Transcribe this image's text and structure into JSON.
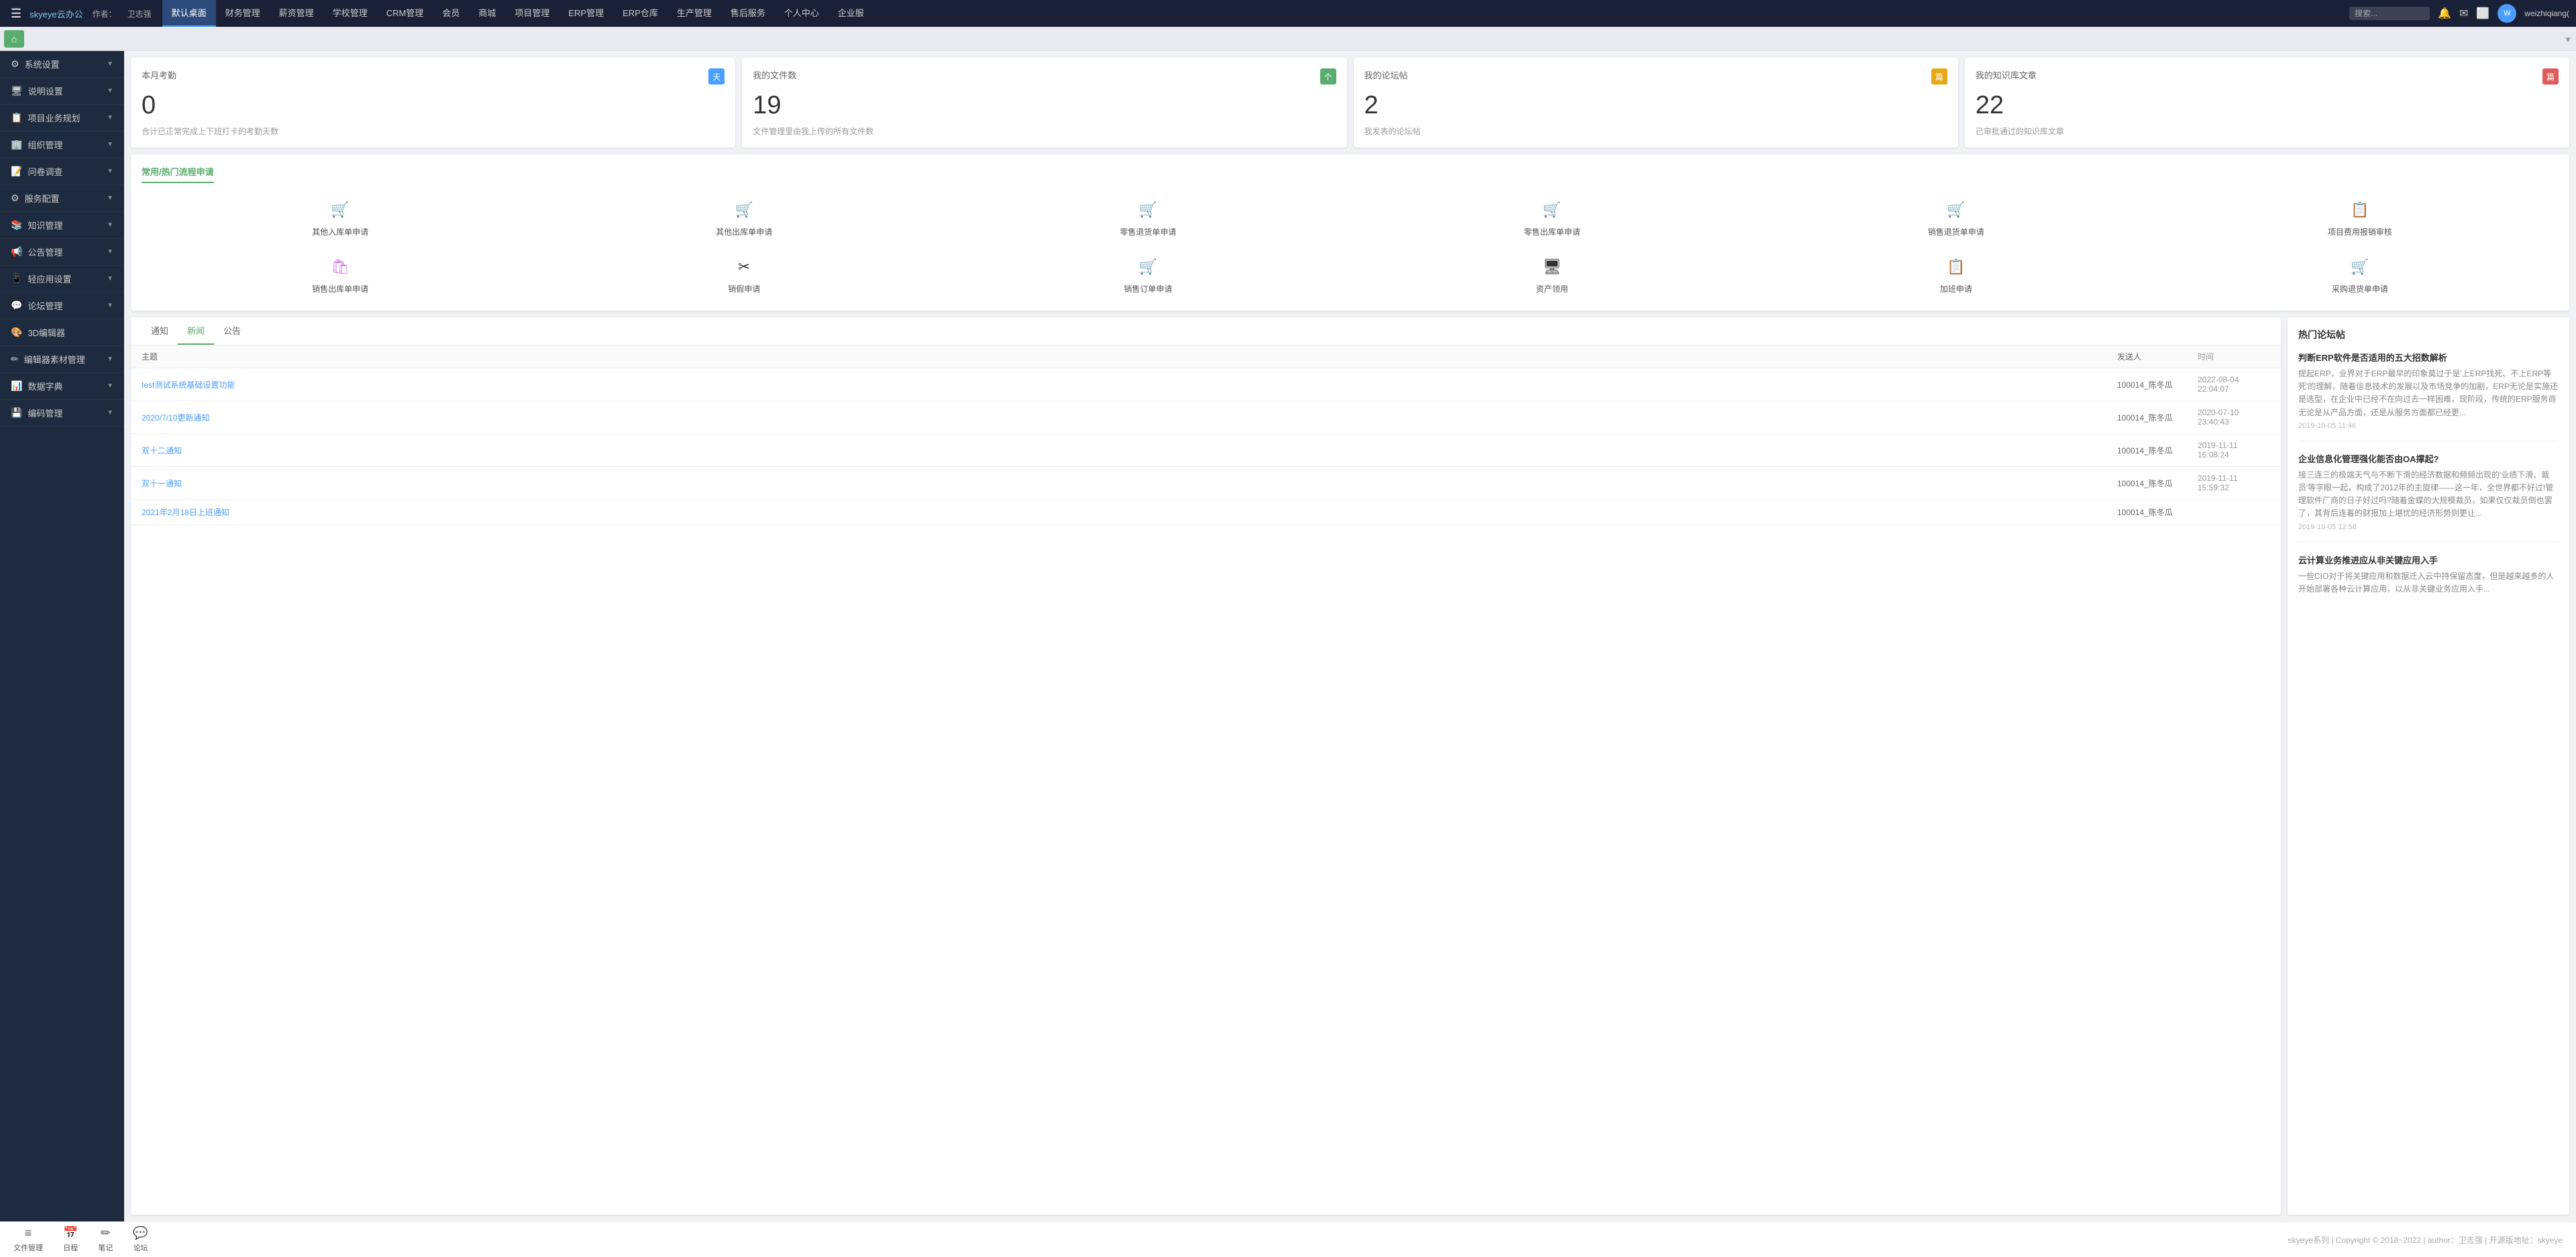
{
  "brand": {
    "name": "skyeye云办公",
    "author_label": "作者：",
    "author": "卫志强"
  },
  "top_nav": {
    "menu_icon": "☰",
    "tabs": [
      {
        "label": "默认桌面",
        "active": true
      },
      {
        "label": "财务管理"
      },
      {
        "label": "薪资管理"
      },
      {
        "label": "学校管理"
      },
      {
        "label": "CRM管理"
      },
      {
        "label": "会员"
      },
      {
        "label": "商城"
      },
      {
        "label": "项目管理"
      },
      {
        "label": "ERP管理"
      },
      {
        "label": "ERP仓库"
      },
      {
        "label": "生产管理"
      },
      {
        "label": "售后服务"
      },
      {
        "label": "个人中心"
      },
      {
        "label": "企业服"
      }
    ],
    "search_placeholder": "搜索...",
    "user": "weizhiqiang("
  },
  "second_nav": {
    "home_icon": "⌂"
  },
  "sidebar": {
    "items": [
      {
        "icon": "⚙",
        "label": "系统设置",
        "has_arrow": true
      },
      {
        "icon": "🖥",
        "label": "说明设置",
        "has_arrow": true
      },
      {
        "icon": "📋",
        "label": "项目业务规划",
        "has_arrow": true
      },
      {
        "icon": "🏢",
        "label": "组织管理",
        "has_arrow": true
      },
      {
        "icon": "📝",
        "label": "问卷调查",
        "has_arrow": true
      },
      {
        "icon": "⚙",
        "label": "服务配置",
        "has_arrow": true
      },
      {
        "icon": "📚",
        "label": "知识管理",
        "has_arrow": true
      },
      {
        "icon": "📢",
        "label": "公告管理",
        "has_arrow": true
      },
      {
        "icon": "📱",
        "label": "轻应用设置",
        "has_arrow": true
      },
      {
        "icon": "💬",
        "label": "论坛管理",
        "has_arrow": true
      },
      {
        "icon": "🎨",
        "label": "3D编辑器",
        "has_arrow": false
      },
      {
        "icon": "✏",
        "label": "编辑器素材管理",
        "has_arrow": true
      },
      {
        "icon": "📊",
        "label": "数据字典",
        "has_arrow": true
      },
      {
        "icon": "💾",
        "label": "编码管理",
        "has_arrow": true
      }
    ]
  },
  "stats": [
    {
      "title": "本月考勤",
      "badge_text": "天",
      "badge_color": "#4a9eff",
      "number": "0",
      "desc": "合计已正常完成上下班打卡的考勤天数"
    },
    {
      "title": "我的文件数",
      "badge_text": "个",
      "badge_color": "#5aad6e",
      "number": "19",
      "desc": "文件管理里由我上传的所有文件数"
    },
    {
      "title": "我的论坛帖",
      "badge_text": "篇",
      "badge_color": "#e6a817",
      "number": "2",
      "desc": "我发表的论坛帖"
    },
    {
      "title": "我的知识库文章",
      "badge_text": "篇",
      "badge_color": "#e05c5c",
      "number": "22",
      "desc": "已审批通过的知识库文章"
    }
  ],
  "flow_section": {
    "title": "常用/热门流程申请",
    "items": [
      {
        "icon": "🛒",
        "icon_color": "#e05c5c",
        "label": "其他入库单申请"
      },
      {
        "icon": "🛒",
        "icon_color": "#e05c5c",
        "label": "其他出库单申请"
      },
      {
        "icon": "🛒",
        "icon_color": "#e05c5c",
        "label": "零售退货单申请"
      },
      {
        "icon": "🛒",
        "icon_color": "#7b5ea7",
        "label": "零售出库单申请"
      },
      {
        "icon": "🛒",
        "icon_color": "#e05c5c",
        "label": "销售退货单申请"
      },
      {
        "icon": "📋",
        "icon_color": "#5aad6e",
        "label": "项目费用报销审核"
      },
      {
        "icon": "🛍",
        "icon_color": "#d47adb",
        "label": "销售出库单申请"
      },
      {
        "icon": "✂",
        "icon_color": "#333",
        "label": "销假申请"
      },
      {
        "icon": "🛒",
        "icon_color": "#e05c5c",
        "label": "销售订单申请"
      },
      {
        "icon": "🖥",
        "icon_color": "#333",
        "label": "资产领用"
      },
      {
        "icon": "📋",
        "icon_color": "#333",
        "label": "加班申请"
      },
      {
        "icon": "🛒",
        "icon_color": "#aaa",
        "label": "采购退货单申请"
      }
    ]
  },
  "news_section": {
    "tabs": [
      {
        "label": "通知",
        "active": false
      },
      {
        "label": "新闻",
        "active": true
      },
      {
        "label": "公告",
        "active": false
      }
    ],
    "columns": {
      "subject": "主题",
      "sender": "发送人",
      "time": "时间"
    },
    "rows": [
      {
        "title": "test测试系统基础设置功能",
        "sender": "100014_陈冬瓜",
        "time": "2022-08-04 22:04:07"
      },
      {
        "title": "2020/7/10更新通知",
        "sender": "100014_陈冬瓜",
        "time": "2020-07-10 23:40:43"
      },
      {
        "title": "双十二通知",
        "sender": "100014_陈冬瓜",
        "time": "2019-11-11 16:08:24"
      },
      {
        "title": "双十一通知",
        "sender": "100014_陈冬瓜",
        "time": "2019-11-11 15:59:32"
      },
      {
        "title": "2021年2月18日上班通知",
        "sender": "100014_陈冬瓜",
        "time": ""
      }
    ]
  },
  "right_panel": {
    "title": "热门论坛帖",
    "items": [
      {
        "title": "判断ERP软件是否适用的五大招数解析",
        "desc": "提起ERP，业界对于ERP最早的印象莫过于是'上ERP找死、不上ERP等死'的理解，随着信息技术的发展以及市场竞争的加剧，ERP无论是实施还是选型，在企业中已经不在向过去一样困难，现阶段，传统的ERP服务商无论是从产品方面，还是从服务方面都已经更...",
        "time": "2019-10-05 11:46"
      },
      {
        "title": "企业信息化管理强化能否由OA撑起?",
        "desc": "接三连三的极端天气与不断下滑的经济数据和频频出现的'业绩下滑、裁员'等字眼一起，构成了2012年的主旋律——这一年，全世界都不好过!管理软件厂商的日子好过吗?随着金蝶的大规模裁员，如果仅仅裁员倒也罢了，其背后连着的财报加上堪忧的经济形势则更让...",
        "time": "2019-10-05 12:58"
      },
      {
        "title": "云计算业务推进应从非关键应用入手",
        "desc": "一些CIO对于将关键应用和数据迁入云中持保留态度，但是越来越多的人开始部署各种云计算应用，以从非关键业务应用入手...",
        "time": ""
      }
    ]
  },
  "bottom_bar": {
    "icons": [
      {
        "icon": "≡",
        "label": "文件管理"
      },
      {
        "icon": "📅",
        "label": "日程"
      },
      {
        "icon": "✏",
        "label": "笔记"
      },
      {
        "icon": "💬",
        "label": "论坛"
      }
    ],
    "footer_text": "skyeye系列 | Copyright © 2018~2022 | author：卫志强 | 开源版地址：skyeye"
  }
}
